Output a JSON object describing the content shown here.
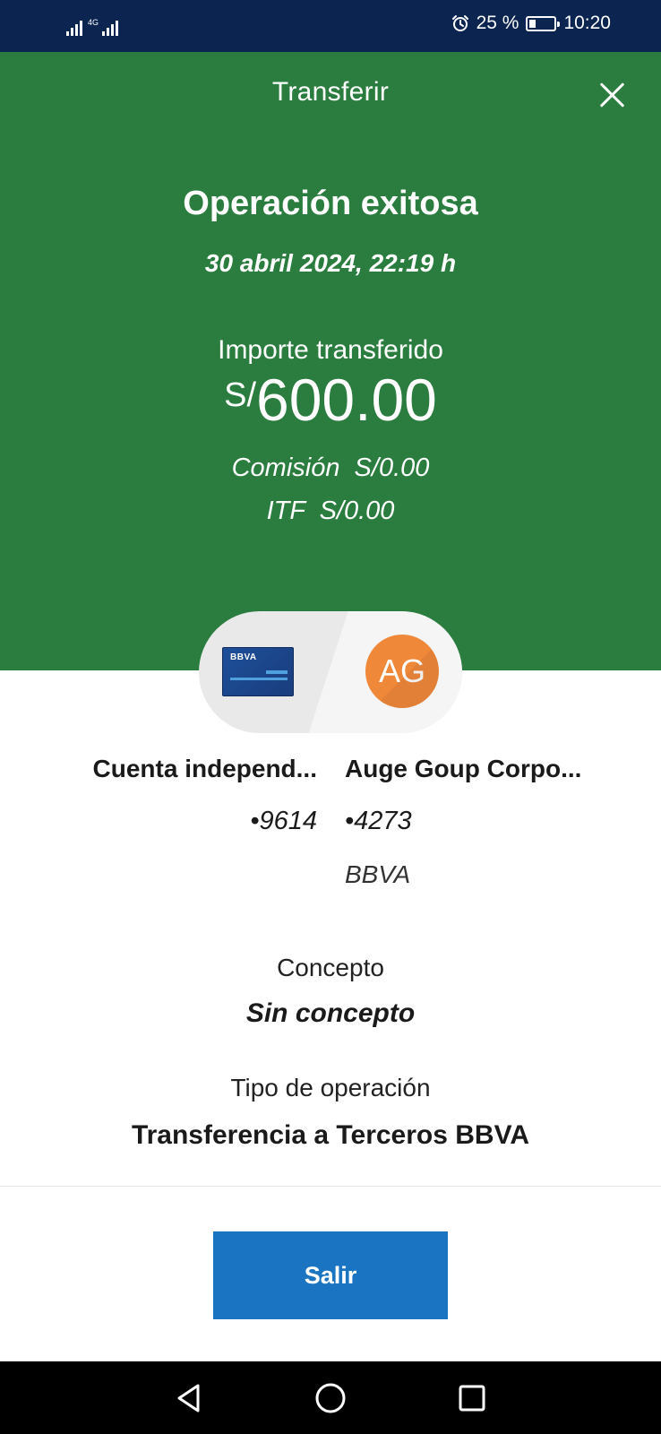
{
  "status_bar": {
    "network": "4G",
    "battery": "25 %",
    "time": "10:20",
    "icons": [
      "signal-icon",
      "alarm-icon",
      "battery-icon"
    ]
  },
  "header": {
    "title": "Transferir",
    "close_icon": "close-icon"
  },
  "result": {
    "title": "Operación exitosa",
    "datetime": "30 abril 2024, 22:19 h",
    "amount_label": "Importe transferido",
    "currency": "S/",
    "amount": "600.00",
    "commission": "Comisión  S/0.00",
    "itf": "ITF  S/0.00"
  },
  "transfer": {
    "from": {
      "card_logo": "BBVA",
      "name": "Cuenta independ...",
      "number": "•9614"
    },
    "to": {
      "initials": "AG",
      "name": "Auge Goup Corpo...",
      "number": "•4273",
      "bank": "BBVA"
    }
  },
  "details": {
    "concept_label": "Concepto",
    "concept_value": "Sin concepto",
    "type_label": "Tipo de operación",
    "type_value": "Transferencia a Terceros BBVA"
  },
  "footer": {
    "exit_label": "Salir"
  },
  "nav": {
    "icons": [
      "back-icon",
      "home-icon",
      "recent-apps-icon"
    ]
  },
  "colors": {
    "status_bar": "#0b2450",
    "header_green": "#2b7d3f",
    "button_blue": "#1a74c1",
    "avatar_orange": "#f0883a",
    "card_blue": "#1d4f9a"
  }
}
